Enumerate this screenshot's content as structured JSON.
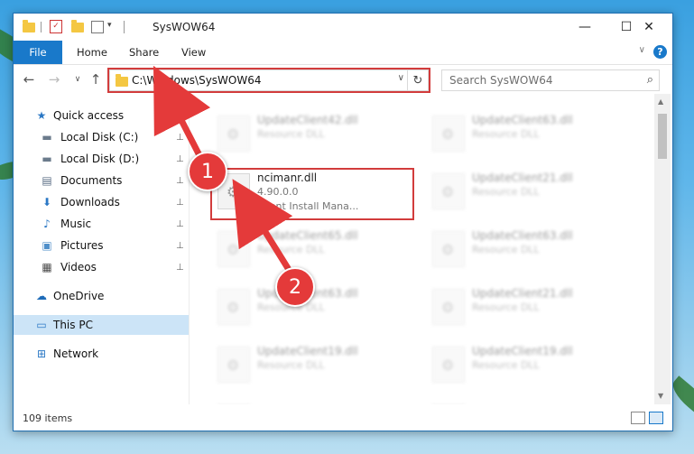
{
  "window": {
    "title": "SysWOW64",
    "minimize_glyph": "—",
    "maximize_glyph": "☐",
    "close_glyph": "✕"
  },
  "ribbon": {
    "tabs": [
      "File",
      "Home",
      "Share",
      "View"
    ],
    "help_glyph": "?",
    "collapse_glyph": "∨"
  },
  "nav": {
    "back_glyph": "←",
    "forward_glyph": "→",
    "recent_glyph": "∨",
    "up_glyph": "↑",
    "address": "C:\\Windows\\SysWOW64",
    "address_dropdown_glyph": "∨",
    "refresh_glyph": "↻",
    "search_placeholder": "Search SysWOW64",
    "search_glyph": "⌕"
  },
  "sidebar": {
    "items": [
      {
        "label": "Quick access",
        "icon": "star-icon",
        "glyph": "★",
        "color": "#2b78c5",
        "pinned": false
      },
      {
        "label": "Local Disk (C:)",
        "icon": "drive-icon",
        "glyph": "▬",
        "color": "#6b7b8c",
        "pinned": true
      },
      {
        "label": "Local Disk (D:)",
        "icon": "drive-icon",
        "glyph": "▬",
        "color": "#6b7b8c",
        "pinned": true
      },
      {
        "label": "Documents",
        "icon": "document-icon",
        "glyph": "▤",
        "color": "#5c6f86",
        "pinned": true
      },
      {
        "label": "Downloads",
        "icon": "download-icon",
        "glyph": "⬇",
        "color": "#2b78c5",
        "pinned": true
      },
      {
        "label": "Music",
        "icon": "music-icon",
        "glyph": "♪",
        "color": "#2b78c5",
        "pinned": true
      },
      {
        "label": "Pictures",
        "icon": "pictures-icon",
        "glyph": "▣",
        "color": "#4f8fc9",
        "pinned": true
      },
      {
        "label": "Videos",
        "icon": "video-icon",
        "glyph": "▦",
        "color": "#4a4a4a",
        "pinned": true
      },
      {
        "label": "OneDrive",
        "icon": "cloud-icon",
        "glyph": "☁",
        "color": "#1e6bb8",
        "pinned": false
      },
      {
        "label": "This PC",
        "icon": "computer-icon",
        "glyph": "▭",
        "color": "#2b78c5",
        "pinned": false,
        "selected": true
      },
      {
        "label": "Network",
        "icon": "network-icon",
        "glyph": "⊞",
        "color": "#2b78c5",
        "pinned": false
      }
    ],
    "pin_glyph": "📌"
  },
  "files": {
    "highlighted": {
      "name": "ncimanr.dll",
      "version": "4.90.0.0",
      "description": "Client Install Mana..."
    },
    "background": [
      {
        "name": "UpdateClient42.dll",
        "type": "Resource DLL"
      },
      {
        "name": "UpdateClient63.dll",
        "type": "Resource DLL"
      },
      {
        "name": "UpdateClient65.dll",
        "type": "Resource DLL"
      },
      {
        "name": "UpdateClient65.dll",
        "type": "Resource DLL"
      },
      {
        "name": "UpdateClient63.dll",
        "type": "Resource DLL"
      },
      {
        "name": "UpdateClient63.dll",
        "type": "Resource DLL"
      },
      {
        "name": "UpdateClient63.dll",
        "type": "Resource DLL"
      },
      {
        "name": "UpdateClient21.dll",
        "type": "Resource DLL"
      },
      {
        "name": "UpdateClient19.dll",
        "type": "Resource DLL"
      },
      {
        "name": "UpdateClient19.dll",
        "type": "Resource DLL"
      },
      {
        "name": "UpdateClient21.dll",
        "type": "Resource DLL"
      }
    ]
  },
  "status": {
    "item_count": "109 items"
  },
  "annotations": {
    "step1": "1",
    "step2": "2",
    "highlight_color": "#d23c3c"
  }
}
